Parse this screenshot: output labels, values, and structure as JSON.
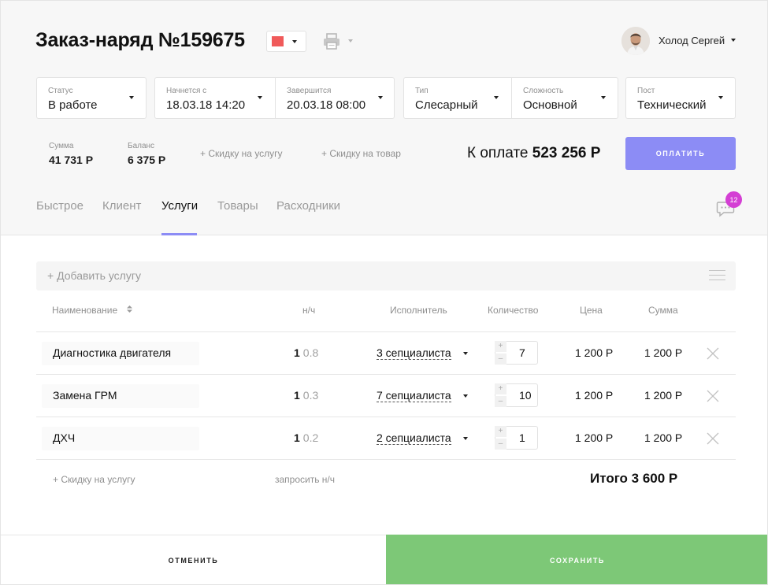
{
  "header": {
    "title": "Заказ-наряд №159675",
    "color_select": {
      "icon": "color-swatch",
      "color": "#f05a5a"
    },
    "print_icon": "printer-icon",
    "user": {
      "name": "Холод Сергей",
      "avatar_icon": "avatar"
    }
  },
  "fields": {
    "status": {
      "label": "Статус",
      "value": "В работе"
    },
    "starts": {
      "label": "Начнется с",
      "value": "18.03.18 14:20"
    },
    "ends": {
      "label": "Завершится",
      "value": "20.03.18 08:00"
    },
    "type": {
      "label": "Тип",
      "value": "Слесарный"
    },
    "complexity": {
      "label": "Сложность",
      "value": "Основной"
    },
    "post": {
      "label": "Пост",
      "value": "Технический"
    }
  },
  "summary": {
    "sum_label": "Сумма",
    "sum_value": "41 731 Р",
    "balance_label": "Баланс",
    "balance_value": "6 375 Р",
    "discount_service": "+ Скидку на услугу",
    "discount_goods": "+ Скидку на товар",
    "to_pay_label": "К оплате",
    "to_pay_value": "523 256 Р",
    "pay_button": "ОПЛАТИТЬ"
  },
  "tabs": [
    {
      "label": "Быстрое",
      "active": false
    },
    {
      "label": "Клиент",
      "active": false
    },
    {
      "label": "Услуги",
      "active": true
    },
    {
      "label": "Товары",
      "active": false
    },
    {
      "label": "Расходники",
      "active": false
    }
  ],
  "chat": {
    "icon": "chat-icon",
    "badge": "12"
  },
  "services": {
    "add_placeholder": "+ Добавить услугу",
    "menu_icon": "menu-icon",
    "columns": [
      "Наименование",
      "н/ч",
      "Исполнитель",
      "Количество",
      "Цена",
      "Сумма"
    ],
    "rows": [
      {
        "name": "Диагностика двигателя",
        "nh_main": "1",
        "nh_extra": "0.8",
        "performer": "3 сепциалиста",
        "qty": "7",
        "price": "1 200 Р",
        "sum": "1 200 Р"
      },
      {
        "name": "Замена ГРМ",
        "nh_main": "1",
        "nh_extra": "0.3",
        "performer": "7 сепциалиста",
        "qty": "10",
        "price": "1 200 Р",
        "sum": "1 200 Р"
      },
      {
        "name": "ДХЧ",
        "nh_main": "1",
        "nh_extra": "0.2",
        "performer": "2 сепциалиста",
        "qty": "1",
        "price": "1 200 Р",
        "sum": "1 200 Р"
      }
    ],
    "stepper_plus": "+",
    "stepper_minus": "–",
    "footer_discount": "+ Скидку на услугу",
    "footer_request": "запросить н/ч",
    "total": "Итого 3 600 Р"
  },
  "footer": {
    "cancel": "ОТМЕНИТЬ",
    "save": "СОХРАНИТЬ"
  },
  "colors": {
    "accent": "#8c8cf5",
    "save": "#7dc877",
    "badge": "#d43fd4"
  }
}
